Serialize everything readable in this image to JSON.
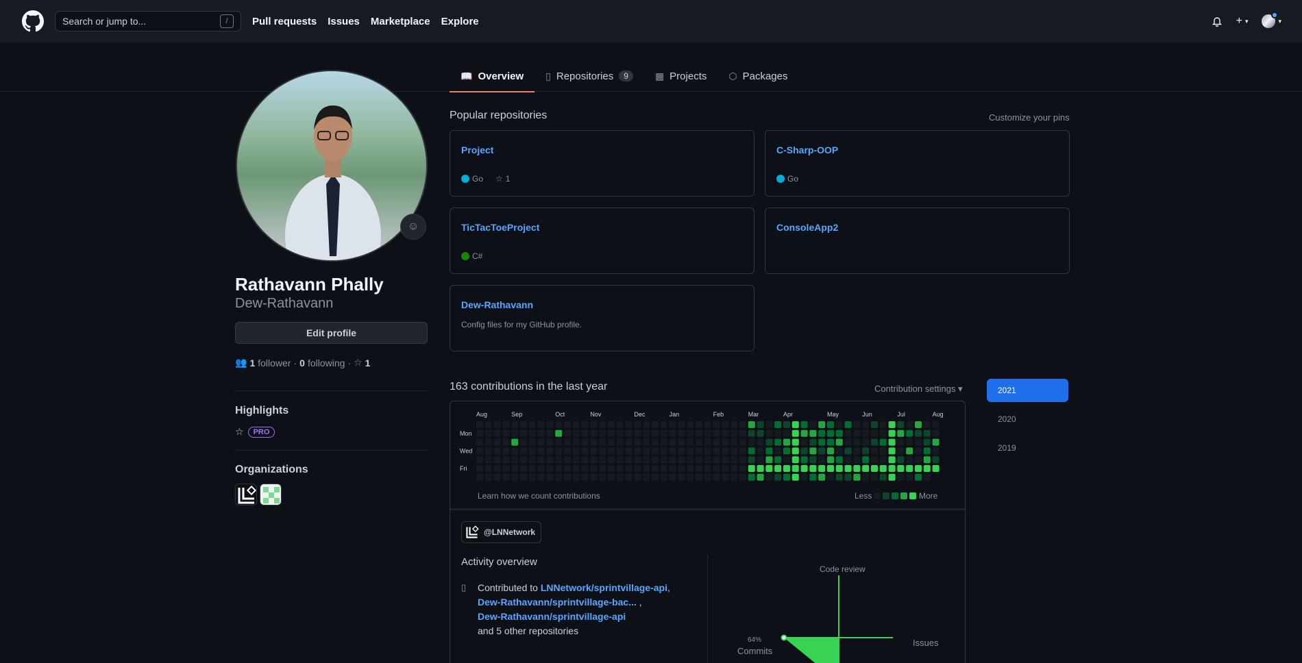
{
  "header": {
    "search_placeholder": "Search or jump to...",
    "search_shortcut": "/",
    "nav": [
      "Pull requests",
      "Issues",
      "Marketplace",
      "Explore"
    ]
  },
  "tabs": [
    {
      "label": "Overview",
      "icon": "book-icon",
      "active": true
    },
    {
      "label": "Repositories",
      "icon": "repo-icon",
      "count": "9"
    },
    {
      "label": "Projects",
      "icon": "project-icon"
    },
    {
      "label": "Packages",
      "icon": "package-icon"
    }
  ],
  "profile": {
    "full_name": "Rathavann Phally",
    "username": "Dew-Rathavann",
    "edit_label": "Edit profile",
    "followers": "1",
    "followers_label": "follower",
    "following": "0",
    "following_label": "following",
    "stars": "1",
    "highlights_title": "Highlights",
    "pro_label": "PRO",
    "orgs_title": "Organizations"
  },
  "popular": {
    "title": "Popular repositories",
    "customize": "Customize your pins",
    "repos": [
      {
        "name": "Project",
        "lang": "Go",
        "lang_color": "#00ADD8",
        "stars": "1",
        "desc": ""
      },
      {
        "name": "C-Sharp-OOP",
        "lang": "Go",
        "lang_color": "#00ADD8",
        "stars": "",
        "desc": ""
      },
      {
        "name": "TicTacToeProject",
        "lang": "C#",
        "lang_color": "#178600",
        "stars": "",
        "desc": ""
      },
      {
        "name": "ConsoleApp2",
        "lang": "",
        "lang_color": "",
        "stars": "",
        "desc": ""
      },
      {
        "name": "Dew-Rathavann",
        "lang": "",
        "lang_color": "",
        "stars": "",
        "desc": "Config files for my GitHub profile."
      }
    ]
  },
  "contributions": {
    "title": "163 contributions in the last year",
    "settings": "Contribution settings",
    "months": [
      "Aug",
      "Sep",
      "Oct",
      "Nov",
      "Dec",
      "Jan",
      "Feb",
      "Mar",
      "Apr",
      "May",
      "Jun",
      "Jul",
      "Aug"
    ],
    "days": [
      "Mon",
      "Wed",
      "Fri"
    ],
    "learn": "Learn how we count contributions",
    "less": "Less",
    "more": "More",
    "years": [
      "2021",
      "2020",
      "2019"
    ],
    "colors": [
      "#161b22",
      "#0e4429",
      "#006d32",
      "#26a641",
      "#39d353"
    ]
  },
  "activity": {
    "org": "@LNNetwork",
    "title": "Activity overview",
    "contributed_to": "Contributed to",
    "repos": [
      "LNNetwork/sprintvillage-api",
      "Dew-Rathavann/sprintvillage-bac...",
      "Dew-Rathavann/sprintvillage-api"
    ],
    "others": "and 5 other repositories",
    "axes": {
      "code_review": "Code review",
      "issues": "Issues",
      "commits": "Commits",
      "commits_pct": "64%"
    }
  }
}
